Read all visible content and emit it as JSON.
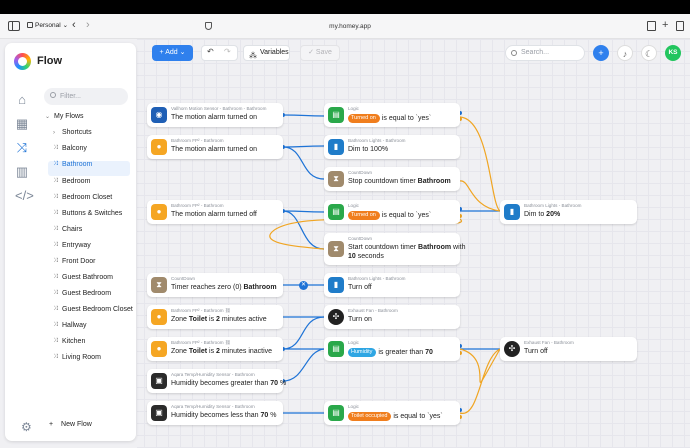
{
  "browser": {
    "profile": "Personal",
    "url": "my.homey.app"
  },
  "sidebar": {
    "app_title": "Flow",
    "filter_placeholder": "Filter...",
    "root": "My Flows",
    "items": [
      {
        "label": "Shortcuts",
        "type": "folder"
      },
      {
        "label": "Balcony",
        "type": "flow"
      },
      {
        "label": "Bathroom",
        "type": "flow",
        "selected": true
      },
      {
        "label": "Bedroom",
        "type": "flow"
      },
      {
        "label": "Bedroom Closet",
        "type": "flow"
      },
      {
        "label": "Buttons & Switches",
        "type": "flow"
      },
      {
        "label": "Chairs",
        "type": "flow"
      },
      {
        "label": "Entryway",
        "type": "flow"
      },
      {
        "label": "Front Door",
        "type": "flow"
      },
      {
        "label": "Guest Bathroom",
        "type": "flow"
      },
      {
        "label": "Guest Bedroom",
        "type": "flow"
      },
      {
        "label": "Guest Bedroom Closet",
        "type": "flow"
      },
      {
        "label": "Hallway",
        "type": "flow"
      },
      {
        "label": "Kitchen",
        "type": "flow"
      },
      {
        "label": "Living Room",
        "type": "flow"
      }
    ],
    "new_flow": "New Flow"
  },
  "toolbar": {
    "add": "Add",
    "variables": "Variables",
    "save": "Save",
    "search_placeholder": "Search...",
    "avatar_initials": "KS"
  },
  "cards": {
    "c1": {
      "sub": "Vallhorn Motion Sensor - Bathroom - Bathroom",
      "main": "The motion alarm turned on"
    },
    "c2": {
      "sub": "Logic",
      "tag": "Turned on",
      "main": "is equal to `yes`"
    },
    "c3": {
      "sub": "Bathroom FP² - Bathroom",
      "main": "The motion alarm turned on"
    },
    "c4": {
      "sub": "Bathroom Lights - Bathroom",
      "main": "Dim to 100%"
    },
    "c5": {
      "sub": "CountDown",
      "main_pre": "Stop countdown timer ",
      "main_bold": "Bathroom"
    },
    "c6": {
      "sub": "Bathroom FP² - Bathroom",
      "main": "The motion alarm turned off"
    },
    "c7": {
      "sub": "Logic",
      "tag": "Turned on",
      "main": "is equal to `yes`"
    },
    "c8": {
      "sub": "Bathroom Lights - Bathroom",
      "main_pre": "Dim to ",
      "main_bold": "20%"
    },
    "c9": {
      "sub": "CountDown",
      "line1_pre": "Start countdown timer ",
      "line1_bold": "Bathroom",
      "line1_post": " with",
      "line2_bold": "10",
      "line2_post": " seconds"
    },
    "c10": {
      "sub": "CountDown",
      "main_pre": "Timer reaches zero (0) ",
      "main_bold": "Bathroom"
    },
    "c11": {
      "sub": "Bathroom Lights - Bathroom",
      "main": "Turn off"
    },
    "c12": {
      "sub": "Bathroom FP² - Bathroom",
      "main_pre": "Zone ",
      "b1": "Toilet",
      "mid": " is ",
      "b2": "2",
      "post": " minutes active"
    },
    "c13": {
      "sub": "Exhaust Fan - Bathroom",
      "main": "Turn on"
    },
    "c14": {
      "sub": "Bathroom FP² - Bathroom",
      "main_pre": "Zone ",
      "b1": "Toilet",
      "mid": " is ",
      "b2": "2",
      "post": " minutes inactive"
    },
    "c15": {
      "sub": "Logic",
      "tag": "Humidity",
      "main_pre": "is greater than ",
      "main_bold": "70"
    },
    "c16": {
      "sub": "Exhaust Fan - Bathroom",
      "main": "Turn off"
    },
    "c17": {
      "sub": "Aqara Temp/Humidity Sensor - Bathroom",
      "main_pre": "Humidity becomes greater than ",
      "main_bold": "70",
      "main_post": " %"
    },
    "c18": {
      "sub": "Aqara Temp/Humidity Sensor - Bathroom",
      "main_pre": "Humidity becomes less than ",
      "main_bold": "70",
      "main_post": " %"
    },
    "c19": {
      "sub": "Logic",
      "tag": "Toilet occupied",
      "main": "is equal to `yes`"
    }
  },
  "colors": {
    "accent": "#2f80ed",
    "wire_true": "#1e73d6",
    "wire_false": "#f0a522",
    "tag_orange": "#f07e1d",
    "tag_blue": "#2fa6e3",
    "avatar": "#22c55e"
  }
}
